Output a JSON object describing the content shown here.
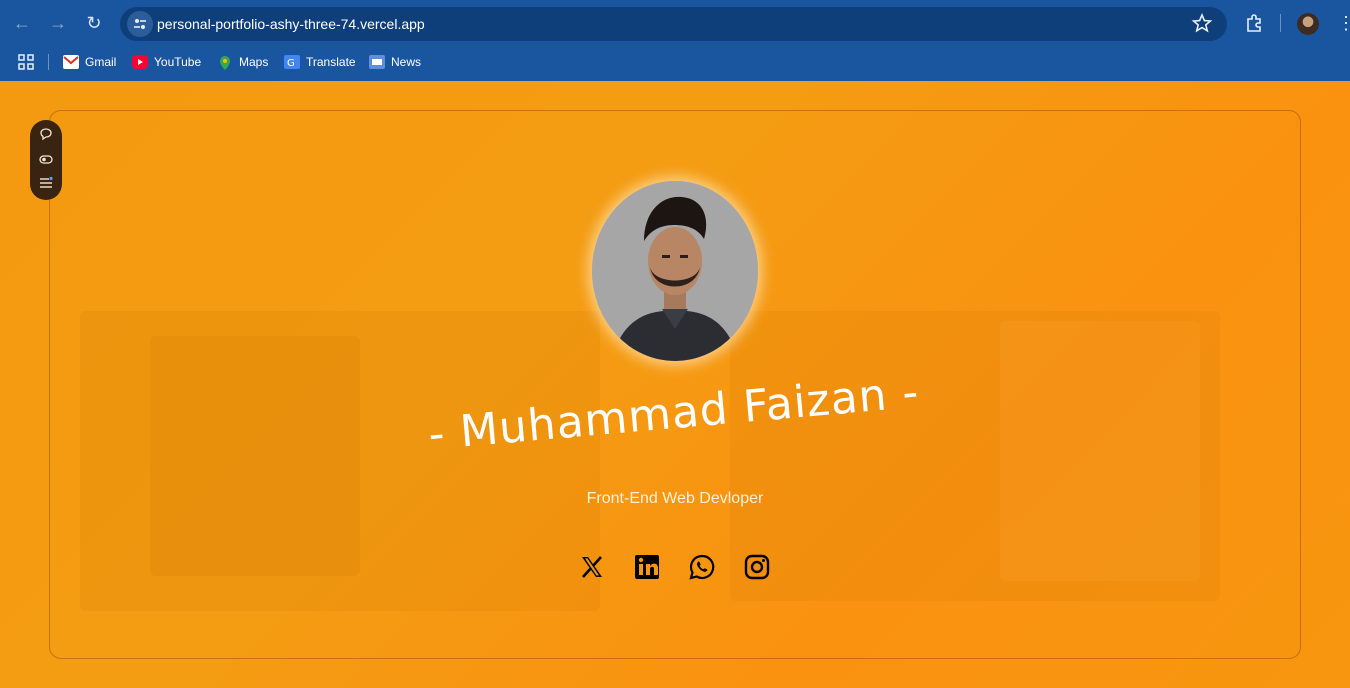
{
  "browser": {
    "url": "personal-portfolio-ashy-three-74.vercel.app",
    "bookmarks": [
      {
        "label": "Gmail",
        "icon": "gmail-icon"
      },
      {
        "label": "YouTube",
        "icon": "youtube-icon"
      },
      {
        "label": "Maps",
        "icon": "maps-icon"
      },
      {
        "label": "Translate",
        "icon": "translate-icon"
      },
      {
        "label": "News",
        "icon": "news-icon"
      }
    ]
  },
  "profile": {
    "name": "- Muhammad Faizan -",
    "role": "Front-End Web Devloper"
  },
  "socials": [
    {
      "icon": "x-twitter-icon"
    },
    {
      "icon": "linkedin-icon"
    },
    {
      "icon": "whatsapp-icon"
    },
    {
      "icon": "instagram-icon"
    }
  ],
  "colors": {
    "background": "#f39a0f",
    "chrome": "#1a56a0",
    "text": "#ffffff"
  }
}
